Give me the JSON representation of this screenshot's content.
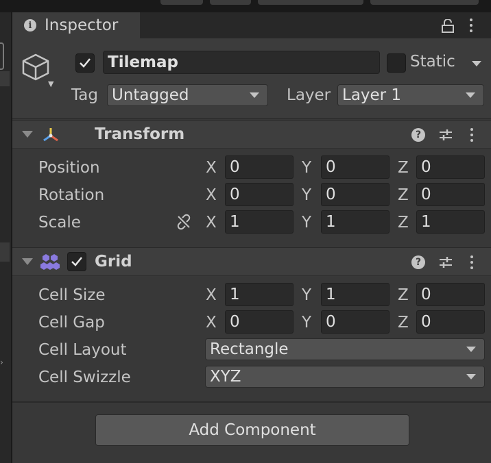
{
  "inspector": {
    "tab_label": "Inspector",
    "icons": {
      "tab": "info-icon",
      "lock": "lock-icon",
      "menu": "kebab-menu-icon"
    }
  },
  "gameobject": {
    "name": "Tilemap",
    "active": true,
    "static_label": "Static",
    "is_static": false,
    "tag_label": "Tag",
    "tag_value": "Untagged",
    "layer_label": "Layer",
    "layer_value": "Layer 1",
    "icon": "cube-icon"
  },
  "transform": {
    "title": "Transform",
    "rows": [
      {
        "label": "Position",
        "x": "0",
        "y": "0",
        "z": "0"
      },
      {
        "label": "Rotation",
        "x": "0",
        "y": "0",
        "z": "0"
      },
      {
        "label": "Scale",
        "x": "1",
        "y": "1",
        "z": "1"
      }
    ],
    "icon": "transform-axes-icon"
  },
  "grid": {
    "title": "Grid",
    "enabled": true,
    "rows": [
      {
        "label": "Cell Size",
        "x": "1",
        "y": "1",
        "z": "0"
      },
      {
        "label": "Cell Gap",
        "x": "0",
        "y": "0",
        "z": "0"
      }
    ],
    "layout_label": "Cell Layout",
    "layout_value": "Rectangle",
    "swizzle_label": "Cell Swizzle",
    "swizzle_value": "XYZ",
    "icon": "grid-hexagon-icon"
  },
  "axes": {
    "x": "X",
    "y": "Y",
    "z": "Z"
  },
  "add_component_label": "Add Component",
  "colors": {
    "panel": "#383838",
    "header": "#3e3e3e",
    "field": "#2a2a2a",
    "button": "#585858",
    "text": "#c4c4c4",
    "grid_icon": "#8a7adf"
  }
}
